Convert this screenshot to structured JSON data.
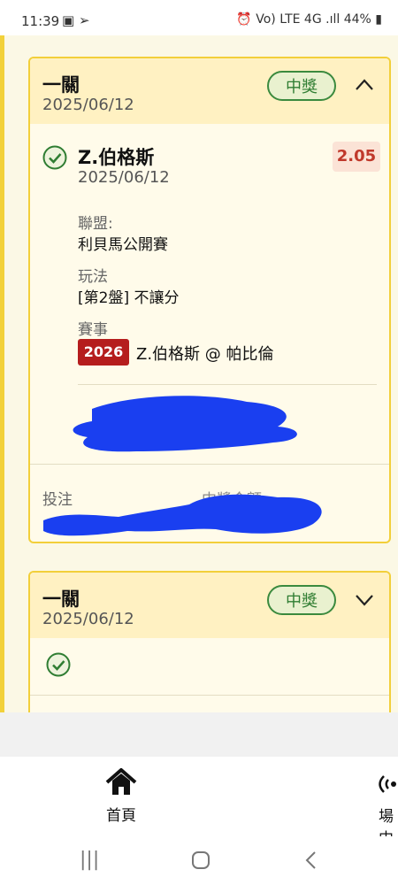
{
  "status_bar": {
    "time": "11:39",
    "left_icons": "▣ ➢",
    "right_icons": "⏰ Vo) LTE 4G .ıll",
    "battery": "44%"
  },
  "cards": [
    {
      "title": "一關",
      "date": "2025/06/12",
      "status_badge": "中獎",
      "expanded": true,
      "selection": {
        "name": "Z.伯格斯",
        "date": "2025/06/12",
        "odds": "2.05",
        "league_label": "聯盟:",
        "league_value": "利貝馬公開賽",
        "play_label": "玩法",
        "play_value": "[第2盤] 不讓分",
        "event_label": "賽事",
        "event_year": "2026",
        "event_match": "Z.伯格斯 @ 帕比倫"
      },
      "bet_label": "投注",
      "payout_label": "中獎金額"
    },
    {
      "title": "一關",
      "date": "2025/06/12",
      "status_badge": "中獎",
      "expanded": false
    }
  ],
  "bottom_nav": {
    "home_label": "首頁",
    "live_label": "場中"
  },
  "colors": {
    "accent_yellow": "#f2cf3a",
    "header_bg": "#fff1c2",
    "win_green": "#2f7d32",
    "odds_red": "#c0392b",
    "year_badge_red": "#b51d1d",
    "redaction_blue": "#1a3ff0"
  }
}
